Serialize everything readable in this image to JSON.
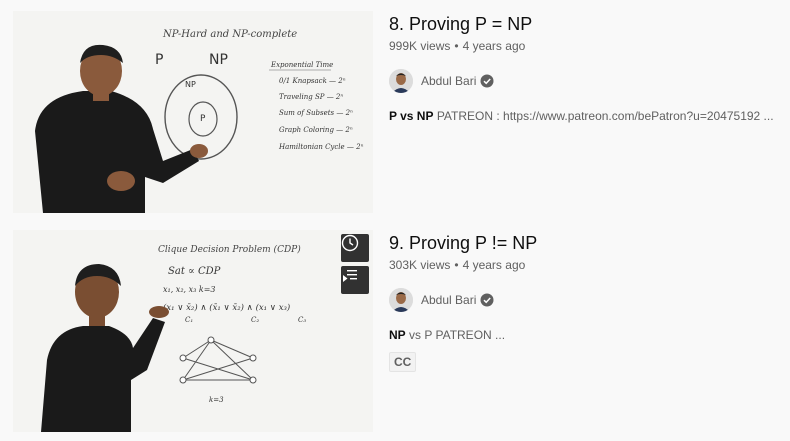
{
  "results": [
    {
      "title": "8. Proving P = NP",
      "views": "999K views",
      "age": "4 years ago",
      "channel": "Abdul Bari",
      "desc_bold": "P vs NP",
      "desc_rest": " PATREON : https://www.patreon.com/bePatron?u=20475192 ...",
      "badge": "",
      "whiteboard": {
        "heading": "NP-Hard and NP-complete",
        "p_label": "P",
        "np_label": "NP",
        "outer_circle": "NP",
        "inner_circle": "P",
        "list_title": "Exponential Time",
        "list": [
          "0/1 Knapsack — 2ⁿ",
          "Traveling SP — 2ⁿ",
          "Sum of Subsets — 2ⁿ",
          "Graph Coloring — 2ⁿ",
          "Hamiltonian Cycle — 2ⁿ"
        ]
      }
    },
    {
      "title": "9. Proving P != NP",
      "views": "303K views",
      "age": "4 years ago",
      "channel": "Abdul Bari",
      "desc_bold": "NP",
      "desc_rest": " vs P PATREON ...",
      "badge": "CC",
      "whiteboard": {
        "heading": "Clique Decision Problem (CDP)",
        "line1": "Sat ∝ CDP",
        "line2": "x₁, x₂, x₃    k=3",
        "formula": "(x₁ ∨ x̄₂) ∧ (x̄₁ ∨ x̄₂) ∧ (x₁ ∨ x₃)",
        "clauses": [
          "C₁",
          "C₂",
          "C₃"
        ],
        "bottom": "k=3"
      }
    }
  ],
  "dot_separator": "•",
  "hover_actions": [
    "watch-later",
    "add-to-queue"
  ]
}
